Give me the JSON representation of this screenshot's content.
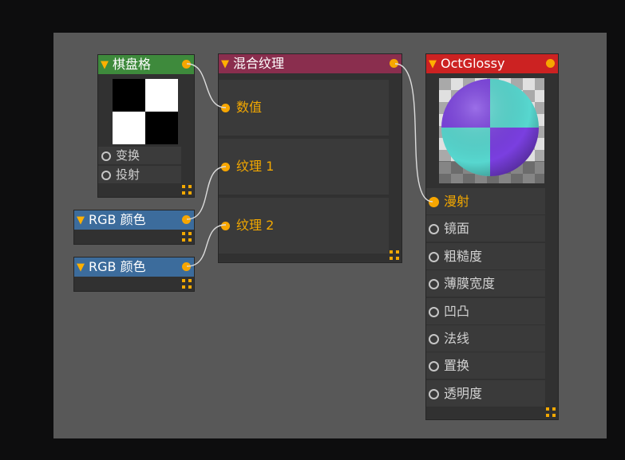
{
  "nodes": {
    "checker": {
      "title": "棋盘格",
      "inputs": [
        "变换",
        "投射"
      ]
    },
    "rgb1": {
      "title": "RGB 颜色"
    },
    "rgb2": {
      "title": "RGB 颜色"
    },
    "mix": {
      "title": "混合纹理",
      "inputs": [
        "数值",
        "纹理 1",
        "纹理 2"
      ]
    },
    "glossy": {
      "title": "OctGlossy",
      "inputs": [
        "漫射",
        "镜面",
        "粗糙度",
        "薄膜宽度",
        "凹凸",
        "法线",
        "置换",
        "透明度"
      ]
    }
  },
  "colors": {
    "canvas": "#585858",
    "node_body": "#313131",
    "accent_pin": "#f7a600",
    "header_checker": "#3e8a3c",
    "header_rgb": "#3c6c9c",
    "header_mix": "#8a2e4e",
    "header_glossy": "#cc2222",
    "sphere_a": "#7a3fe0",
    "sphere_b": "#57d7cf"
  },
  "icons": {
    "collapse": "triangle-down-icon",
    "expand": "expand-corners-icon"
  }
}
